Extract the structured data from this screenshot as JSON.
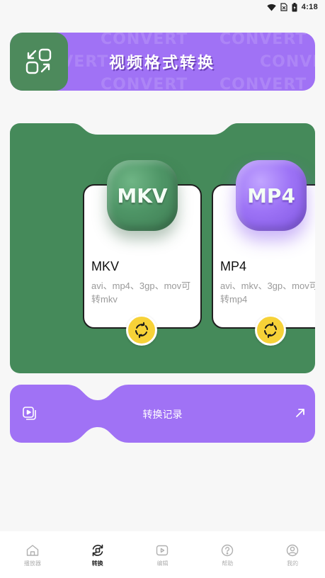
{
  "status_bar": {
    "time": "4:18"
  },
  "banner": {
    "title": "视频格式转换",
    "watermark": "CONVERT",
    "icon": "convert-arrows-icon",
    "colors": {
      "bg": "#a072f5",
      "icon_bg": "#4d8a5c"
    }
  },
  "formats": [
    {
      "badge": "MKV",
      "name": "MKV",
      "desc": "avi、mp4、3gp、mov可转mkv",
      "color": "green"
    },
    {
      "badge": "MP4",
      "name": "MP4",
      "desc": "avi、mkv、3gp、mov可转mp4",
      "color": "purple"
    }
  ],
  "history": {
    "label": "转换记录",
    "icon": "video-history-icon",
    "arrow_icon": "arrow-up-right-icon"
  },
  "nav": [
    {
      "label": "播放器",
      "icon": "home-icon",
      "active": false
    },
    {
      "label": "转换",
      "icon": "convert-icon",
      "active": true
    },
    {
      "label": "编辑",
      "icon": "edit-video-icon",
      "active": false
    },
    {
      "label": "帮助",
      "icon": "help-icon",
      "active": false
    },
    {
      "label": "我的",
      "icon": "profile-icon",
      "active": false
    }
  ],
  "colors": {
    "green": "#458a5a",
    "purple": "#a072f5",
    "yellow": "#f7d238"
  }
}
